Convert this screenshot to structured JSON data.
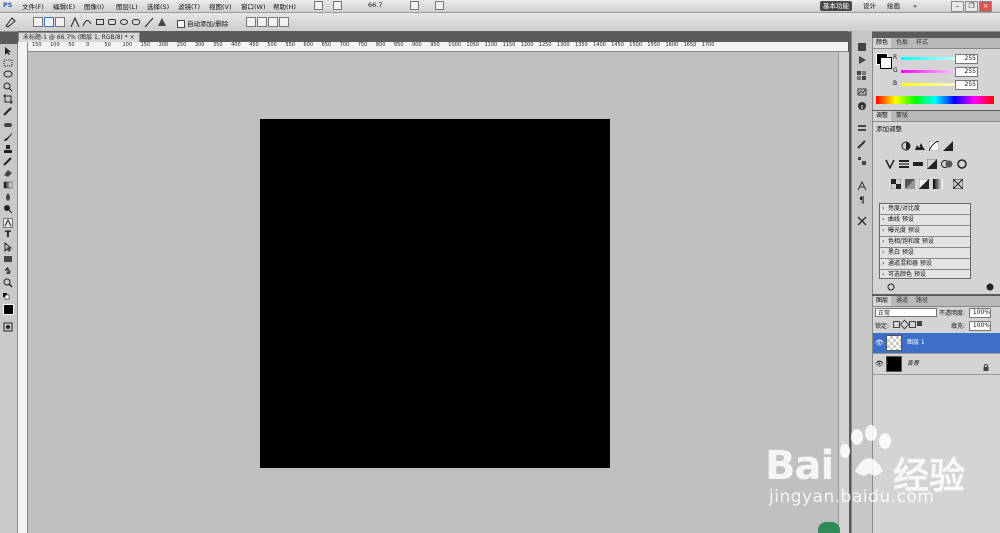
{
  "app": {
    "logo": "PS"
  },
  "menu": [
    {
      "id": "file",
      "label": "文件(F)"
    },
    {
      "id": "edit",
      "label": "编辑(E)"
    },
    {
      "id": "image",
      "label": "图像(I)"
    },
    {
      "id": "layer",
      "label": "图层(L)"
    },
    {
      "id": "select",
      "label": "选择(S)"
    },
    {
      "id": "filter",
      "label": "滤镜(T)"
    },
    {
      "id": "view",
      "label": "视图(V)"
    },
    {
      "id": "window",
      "label": "窗口(W)"
    },
    {
      "id": "help",
      "label": "帮助(H)"
    }
  ],
  "zoom_dropdown": "66.7",
  "workspaces": {
    "basic": "基本功能",
    "design": "设计",
    "paint": "绘画",
    "more": "»"
  },
  "options_bar": {
    "auto_add_delete": "自动添加/删除"
  },
  "document": {
    "tab_title": "未标题-1 @ 66.7% (图层 1, RGB/8) *",
    "close": "×"
  },
  "ruler": {
    "h_ticks": [
      "150",
      "100",
      "50",
      "0",
      "50",
      "100",
      "150",
      "200",
      "250",
      "300",
      "350",
      "400",
      "450",
      "500",
      "550",
      "600",
      "650",
      "700",
      "750",
      "800",
      "850",
      "900",
      "950",
      "1000",
      "1050",
      "1100",
      "1150",
      "1200",
      "1250",
      "1300",
      "1350",
      "1400",
      "1450",
      "1500",
      "1550",
      "1600",
      "1650",
      "1700"
    ]
  },
  "color_panel": {
    "tabs": [
      "颜色",
      "色板",
      "样式"
    ],
    "r_label": "R",
    "g_label": "G",
    "b_label": "B",
    "r": "255",
    "g": "255",
    "b": "255"
  },
  "adjustments_panel": {
    "tabs": [
      "调整",
      "蒙版"
    ],
    "title": "添加调整",
    "presets": [
      "亮度/对比度",
      "曲线 预设",
      "曝光度 预设",
      "色相/饱和度 预设",
      "黑白 预设",
      "通道混和器 预设",
      "可选颜色 预设"
    ]
  },
  "layers_panel": {
    "tabs": [
      "图层",
      "通道",
      "路径"
    ],
    "blend_mode": "正常",
    "opacity_label": "不透明度:",
    "opacity": "100%",
    "lock_label": "锁定:",
    "fill_label": "填充:",
    "fill": "100%",
    "layers": [
      {
        "name": "图层 1",
        "selected": true,
        "thumb": "transparent"
      },
      {
        "name": "背景",
        "selected": false,
        "thumb": "black"
      }
    ]
  },
  "watermark": {
    "brand": "Bai",
    "brand2": "du",
    "cn": "经验",
    "url": "jingyan.baidu.com"
  },
  "colors": {
    "accent_select": "#3d6fc7",
    "artboard": "#000000",
    "workarea": "#c0c0c0",
    "chrome": "#5b5b5b"
  }
}
